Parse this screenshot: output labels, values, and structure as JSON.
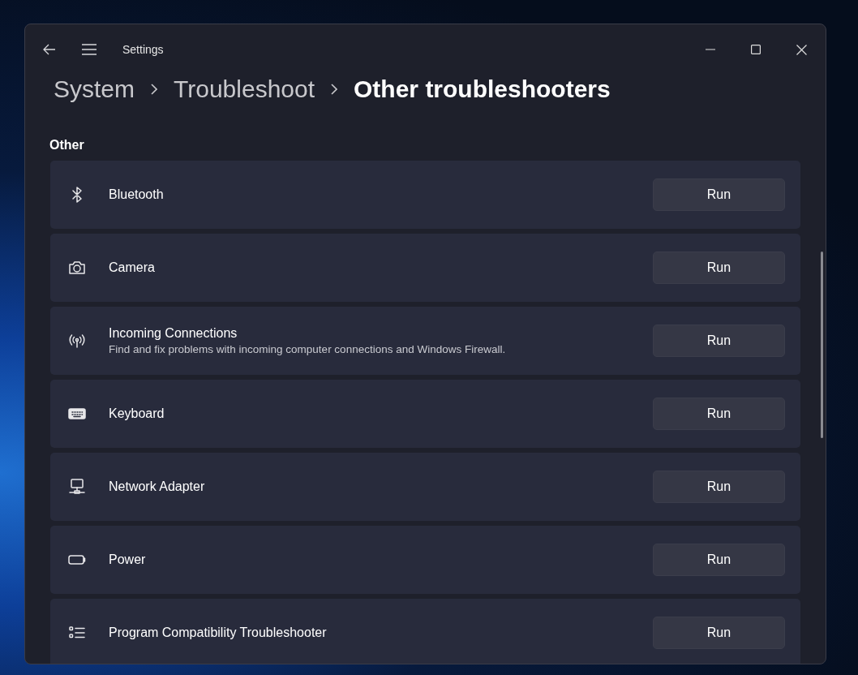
{
  "window": {
    "title": "Settings"
  },
  "breadcrumb": [
    {
      "label": "System",
      "selected": false
    },
    {
      "label": "Troubleshoot",
      "selected": false
    },
    {
      "label": "Other troubleshooters",
      "selected": true
    }
  ],
  "section": {
    "heading": "Other"
  },
  "items": [
    {
      "title": "Bluetooth",
      "button": "Run"
    },
    {
      "title": "Camera",
      "button": "Run"
    },
    {
      "title": "Incoming Connections",
      "description": "Find and fix problems with incoming computer connections and Windows Firewall.",
      "button": "Run"
    },
    {
      "title": "Keyboard",
      "button": "Run"
    },
    {
      "title": "Network Adapter",
      "button": "Run"
    },
    {
      "title": "Power",
      "button": "Run"
    },
    {
      "title": "Program Compatibility Troubleshooter",
      "button": "Run"
    }
  ]
}
